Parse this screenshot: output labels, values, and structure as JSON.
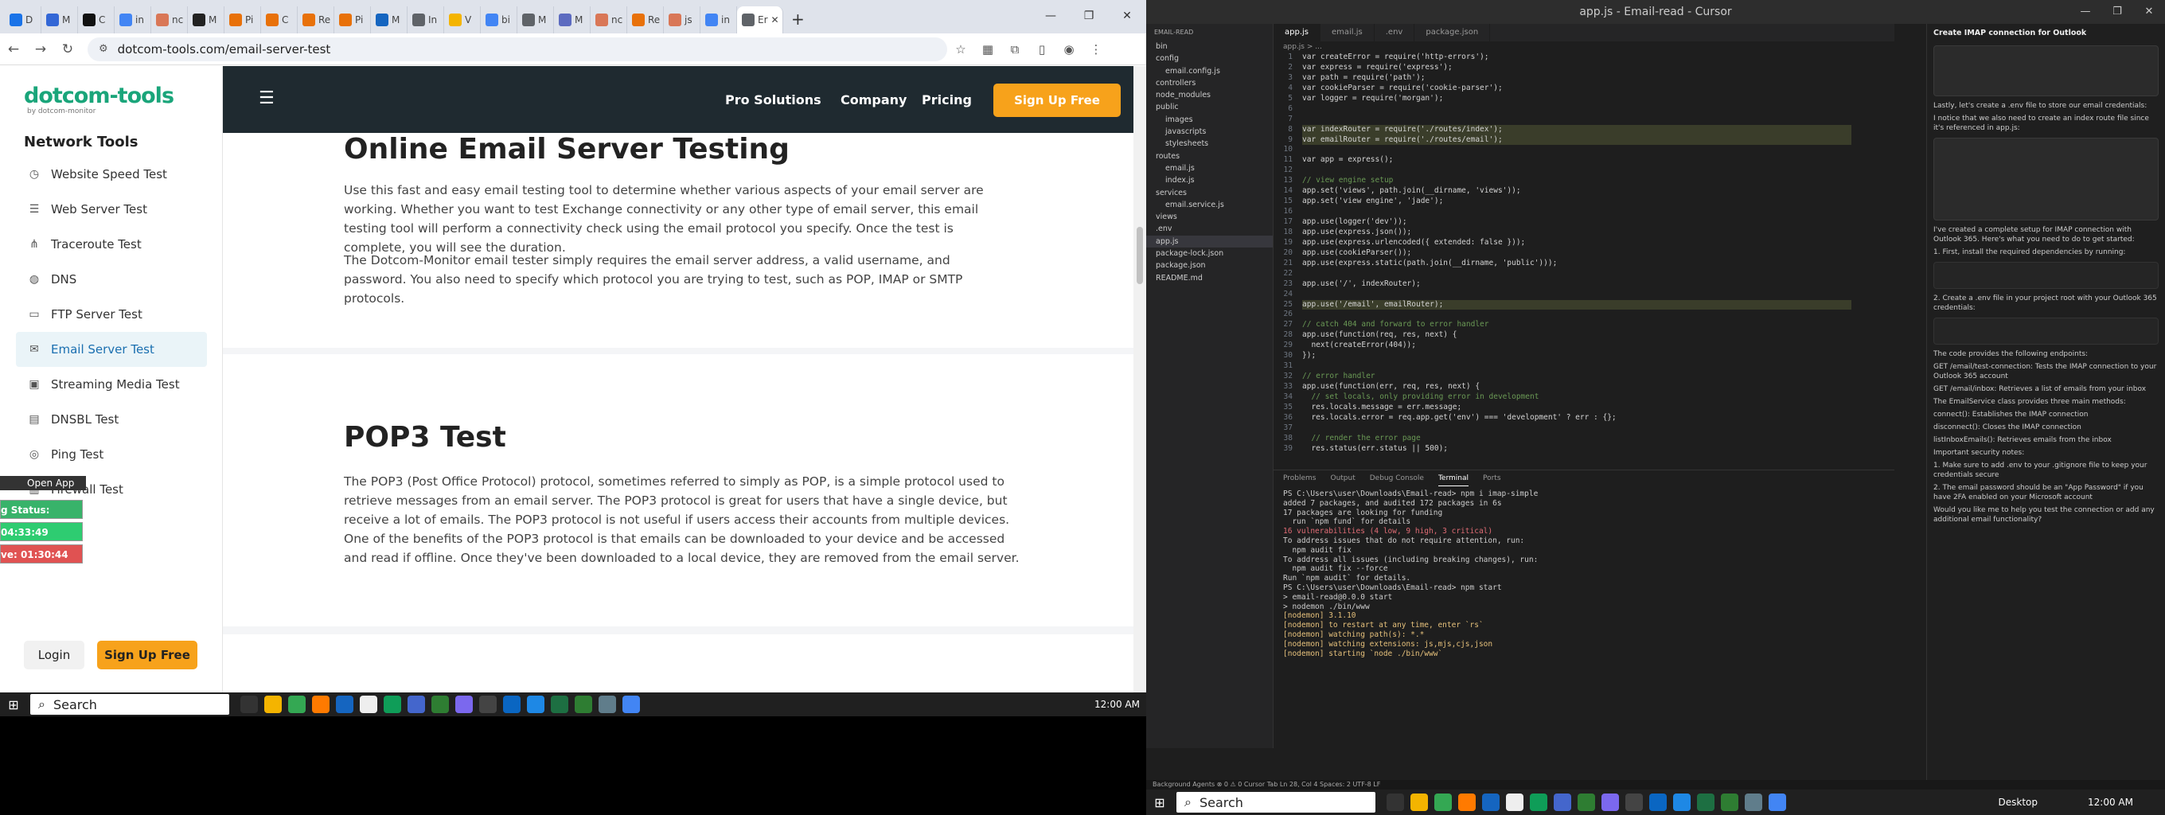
{
  "browser": {
    "tabs": [
      {
        "label": "D",
        "color": "#1a73e8"
      },
      {
        "label": "M",
        "color": "#3367d6"
      },
      {
        "label": "C",
        "color": "#111111"
      },
      {
        "label": "in",
        "color": "#4285f4"
      },
      {
        "label": "nc",
        "color": "#d97757"
      },
      {
        "label": "M",
        "color": "#222222"
      },
      {
        "label": "Pi",
        "color": "#e8710a"
      },
      {
        "label": "C",
        "color": "#e8710a"
      },
      {
        "label": "Re",
        "color": "#e8710a"
      },
      {
        "label": "Pi",
        "color": "#e8710a"
      },
      {
        "label": "M",
        "color": "#1565c0"
      },
      {
        "label": "In",
        "color": "#5f6368"
      },
      {
        "label": "V",
        "color": "#f4b400"
      },
      {
        "label": "bi",
        "color": "#4285f4"
      },
      {
        "label": "M",
        "color": "#5f6368"
      },
      {
        "label": "M",
        "color": "#5c6bc0"
      },
      {
        "label": "nc",
        "color": "#d97757"
      },
      {
        "label": "Re",
        "color": "#e8710a"
      },
      {
        "label": "js",
        "color": "#d97757"
      },
      {
        "label": "in",
        "color": "#4285f4"
      },
      {
        "label": "Er",
        "color": "#5f6368"
      }
    ],
    "new_tab": "+",
    "url": "dotcom-tools.com/email-server-test"
  },
  "site": {
    "logo": "dotcom-tools",
    "logo_sub": "by dotcom-monitor",
    "nav_title": "Network Tools",
    "nav_items": [
      {
        "label": "Website Speed Test",
        "icon": "◷"
      },
      {
        "label": "Web Server Test",
        "icon": "☰"
      },
      {
        "label": "Traceroute Test",
        "icon": "⋔"
      },
      {
        "label": "DNS",
        "icon": "◍"
      },
      {
        "label": "FTP Server Test",
        "icon": "▭"
      },
      {
        "label": "Email Server Test",
        "icon": "✉"
      },
      {
        "label": "Streaming Media Test",
        "icon": "▣"
      },
      {
        "label": "DNSBL Test",
        "icon": "▤"
      },
      {
        "label": "Ping Test",
        "icon": "◎"
      },
      {
        "label": "Firewall Test",
        "icon": "▥"
      }
    ],
    "login": "Login",
    "signup": "Sign Up Free",
    "top_links": [
      "Pro Solutions",
      "Company",
      "Pricing"
    ],
    "top_signup": "Sign Up Free",
    "sec1_title": "Online Email Server Testing",
    "sec1_p1": "Use this fast and easy email testing tool to determine whether various aspects of your email server are working. Whether you want to test Exchange connectivity or any other type of email server, this email testing tool will perform a connectivity check using the email protocol you specify. Once the test is complete, you will see the duration.",
    "sec1_p2": "The Dotcom-Monitor email tester simply requires the email server address, a valid username, and password. You also need to specify which protocol you are trying to test, such as POP, IMAP or SMTP protocols.",
    "sec2_title": "POP3 Test",
    "sec2_p1": "The POP3 (Post Office Protocol) protocol, sometimes referred to simply as POP, is a simple protocol used to retrieve messages from an email server. The POP3 protocol is great for users that have a single device, but receive a lot of emails. The POP3 protocol is not useful if users access their accounts from multiple devices. One of the benefits of the POP3 protocol is that emails can be downloaded to your device and be accessed and read if offline. Once they've been downloaded to a local device, they are removed from the email server."
  },
  "overlay": {
    "open_app": "Open App",
    "status": "g Status: Active",
    "time1": "04:33:49",
    "time2": "ve: 01:30:44"
  },
  "taskbar_left": {
    "search": "Search",
    "clock": "12:00 AM"
  },
  "cursor": {
    "title": "app.js - Email-read - Cursor",
    "explorer_header": "EMAIL-READ",
    "tree": [
      "bin",
      "config",
      "email.config.js",
      "controllers",
      "node_modules",
      "public",
      "images",
      "javascripts",
      "stylesheets",
      "routes",
      "email.js",
      "index.js",
      "services",
      "email.service.js",
      "views",
      ".env",
      "app.js",
      "package-lock.json",
      "package.json",
      "README.md"
    ],
    "tabs": [
      "app.js",
      "email.js",
      ".env",
      "package.json"
    ],
    "breadcrumb": "app.js > ...",
    "code": [
      "var createError = require('http-errors');",
      "var express = require('express');",
      "var path = require('path');",
      "var cookieParser = require('cookie-parser');",
      "var logger = require('morgan');",
      "",
      "",
      "var indexRouter = require('./routes/index');",
      "var emailRouter = require('./routes/email');",
      "",
      "var app = express();",
      "",
      "// view engine setup",
      "app.set('views', path.join(__dirname, 'views'));",
      "app.set('view engine', 'jade');",
      "",
      "app.use(logger('dev'));",
      "app.use(express.json());",
      "app.use(express.urlencoded({ extended: false }));",
      "app.use(cookieParser());",
      "app.use(express.static(path.join(__dirname, 'public')));",
      "",
      "app.use('/', indexRouter);",
      "",
      "app.use('/email', emailRouter);",
      "",
      "// catch 404 and forward to error handler",
      "app.use(function(req, res, next) {",
      "  next(createError(404));",
      "});",
      "",
      "// error handler",
      "app.use(function(err, req, res, next) {",
      "  // set locals, only providing error in development",
      "  res.locals.message = err.message;",
      "  res.locals.error = req.app.get('env') === 'development' ? err : {};",
      "",
      "  // render the error page",
      "  res.status(err.status || 500);"
    ],
    "panel_tabs": [
      "Problems",
      "Output",
      "Debug Console",
      "Terminal",
      "Ports"
    ],
    "terminal": [
      "PS C:\\Users\\user\\Downloads\\Email-read> npm i imap-simple",
      "",
      "added 7 packages, and audited 172 packages in 6s",
      "",
      "17 packages are looking for funding",
      "  run `npm fund` for details",
      "",
      "16 vulnerabilities (4 low, 9 high, 3 critical)",
      "",
      "To address issues that do not require attention, run:",
      "  npm audit fix",
      "",
      "To address all issues (including breaking changes), run:",
      "  npm audit fix --force",
      "",
      "Run `npm audit` for details.",
      "PS C:\\Users\\user\\Downloads\\Email-read> npm start",
      "",
      "> email-read@0.0.0 start",
      "> nodemon ./bin/www",
      "",
      "[nodemon] 3.1.10",
      "[nodemon] to restart at any time, enter `rs`",
      "[nodemon] watching path(s): *.*",
      "[nodemon] watching extensions: js,mjs,cjs,json",
      "[nodemon] starting `node ./bin/www`"
    ],
    "chat_title": "Create IMAP connection for Outlook",
    "chat_text": [
      "Lastly, let's create a .env file to store our email credentials:",
      "I notice that we also need to create an index route file since it's referenced in app.js:",
      "I've created a complete setup for IMAP connection with Outlook 365. Here's what you need to do to get started:",
      "1. First, install the required dependencies by running:",
      "2. Create a .env file in your project root with your Outlook 365 credentials:",
      "The code provides the following endpoints:",
      "GET /email/test-connection: Tests the IMAP connection to your Outlook 365 account",
      "GET /email/inbox: Retrieves a list of emails from your inbox",
      "The EmailService class provides three main methods:",
      "connect(): Establishes the IMAP connection",
      "disconnect(): Closes the IMAP connection",
      "listInboxEmails(): Retrieves emails from the inbox",
      "Important security notes:",
      "1. Make sure to add .env to your .gitignore file to keep your credentials secure",
      "2. The email password should be an \"App Password\" if you have 2FA enabled on your Microsoft account",
      "Would you like me to help you test the connection or add any additional email functionality?"
    ],
    "status": "Background Agents   ⊗ 0 ⚠ 0          Cursor Tab   Ln 28, Col 4   Spaces: 2   UTF-8   LF",
    "search": "Search",
    "desktop": "Desktop",
    "clock": "12:00 AM"
  },
  "colors": {
    "accent": "#f7a21b",
    "brand": "#1aa57a",
    "active_nav": "#1a6fb0"
  }
}
